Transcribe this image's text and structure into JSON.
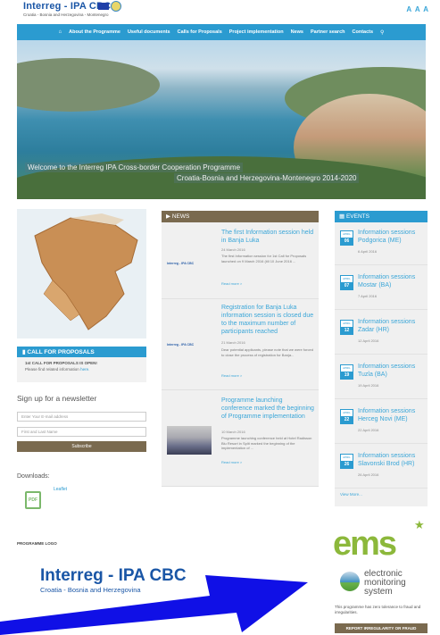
{
  "header": {
    "logo_title": "Interreg - IPA CBC",
    "logo_subtitle": "Croatia - Bosnia and Herzegovina - Montenegro",
    "font_size_control": "A A A"
  },
  "nav": {
    "home_icon": "home-icon",
    "items": [
      "About the Programme",
      "Useful documents",
      "Calls for Proposals",
      "Project implementation",
      "News",
      "Partner search",
      "Contacts"
    ],
    "search_icon": "search-icon"
  },
  "hero": {
    "caption_line1": "Welcome to the Interreg IPA Cross-border Cooperation Programme",
    "caption_line2": "Croatia-Bosnia and Herzegovina-Montenegro 2014-2020"
  },
  "call_for_proposals": {
    "title": "CALL FOR PROPOSALS",
    "line1": "1st CALL FOR PROPOSALS IS OPEN!",
    "line2": "Please find related information",
    "link": "here."
  },
  "newsletter": {
    "title": "Sign up for a newsletter",
    "email_placeholder": "Enter Your E-mail address",
    "name_placeholder": "First and Last Name",
    "subscribe_label": "Subscribe"
  },
  "downloads": {
    "title": "Downloads:",
    "file_label": "Leaflet",
    "file_type": "PDF"
  },
  "news": {
    "header": "NEWS",
    "items": [
      {
        "title": "The first Information session held in Banja Luka",
        "date": "24 March 2016",
        "text": "The first Information session for 1st Call for Proposals launched on 9 March 2016 (till 10 June 2016 ...",
        "more": "Read more >",
        "thumb": "Interreg - IPA CBC"
      },
      {
        "title": "Registration for Banja Luka information session is closed due to the maximum number of participants reached",
        "date": "21 March 2016",
        "text": "Dear potential applicants, please note that we were forced to close the process of registration for Banja...",
        "more": "Read more >",
        "thumb": "Interreg - IPA CBC"
      },
      {
        "title": "Programme launching conference marked the beginning of Programme implementation",
        "date": "10 March 2016",
        "text": "Programme launching conference held at Hotel Radisson Blu Resort in Split marked the beginning of the implementation of ...",
        "more": "Read more >"
      }
    ]
  },
  "events": {
    "header": "EVENTS",
    "items": [
      {
        "month": "APRIL",
        "day": "06",
        "title": "Information sessions Podgorica (ME)",
        "date": "6 April 2016"
      },
      {
        "month": "APRIL",
        "day": "07",
        "title": "Information sessions Mostar (BA)",
        "date": "7 April 2016"
      },
      {
        "month": "APRIL",
        "day": "12",
        "title": "Information sessions Zadar (HR)",
        "date": "12 April 2016"
      },
      {
        "month": "APRIL",
        "day": "19",
        "title": "Information sessions Tuzla (BA)",
        "date": "19 April 2016"
      },
      {
        "month": "APRIL",
        "day": "22",
        "title": "Information sessions Herceg Novi (ME)",
        "date": "22 April 2016"
      },
      {
        "month": "APRIL",
        "day": "26",
        "title": "Information sessions Slavonski Brod (HR)",
        "date": "26 April 2016"
      }
    ],
    "view_more": "View More..."
  },
  "programme_logo": {
    "label": "PROGRAMME LOGO",
    "title": "Interreg - IPA CBC",
    "subtitle": "Croatia - Bosnia and Herzegovina"
  },
  "ems": {
    "logo": "ems",
    "line1": "electronic",
    "line2": "monitoring",
    "line3": "system",
    "note": "This programme has zero tolerance to fraud and irregularities.",
    "report_label": "REPORT IRREGULARITY OR FRAUD"
  },
  "colors": {
    "accent": "#2b9bd0",
    "brown": "#7a6a4f",
    "ems_green": "#8cb83b",
    "arrow": "#1010e6"
  }
}
